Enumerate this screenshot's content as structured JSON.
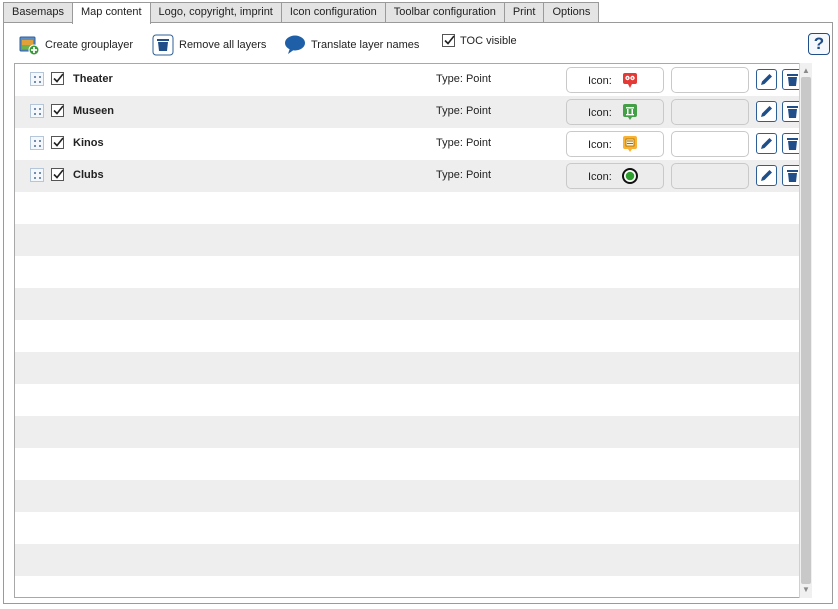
{
  "tabs": [
    {
      "label": "Basemaps"
    },
    {
      "label": "Map content"
    },
    {
      "label": "Logo, copyright, imprint"
    },
    {
      "label": "Icon configuration"
    },
    {
      "label": "Toolbar configuration"
    },
    {
      "label": "Print"
    },
    {
      "label": "Options"
    }
  ],
  "active_tab": "Map content",
  "toolbar": {
    "create_grouplayer_label": "Create grouplayer",
    "remove_all_layers_label": "Remove all layers",
    "translate_layer_names_label": "Translate layer names",
    "toc_visible_label": "TOC visible",
    "toc_visible_checked": true,
    "help_label": "?"
  },
  "layers": [
    {
      "name": "Theater",
      "type": "Type: Point",
      "icon_label": "Icon:",
      "icon": "theater-masks-icon",
      "icon_color": "#e53935",
      "checked": true
    },
    {
      "name": "Museen",
      "type": "Type: Point",
      "icon_label": "Icon:",
      "icon": "museum-icon",
      "icon_color": "#43a047",
      "checked": true
    },
    {
      "name": "Kinos",
      "type": "Type: Point",
      "icon_label": "Icon:",
      "icon": "cinema-icon",
      "icon_color": "#f9b233",
      "checked": true
    },
    {
      "name": "Clubs",
      "type": "Type: Point",
      "icon_label": "Icon:",
      "icon": "circle-target-icon",
      "icon_color": "#2e7d32",
      "checked": true
    }
  ],
  "colors": {
    "accent": "#1f4e89",
    "row_alt": "#eeeeee",
    "border": "#9a9a9a"
  }
}
